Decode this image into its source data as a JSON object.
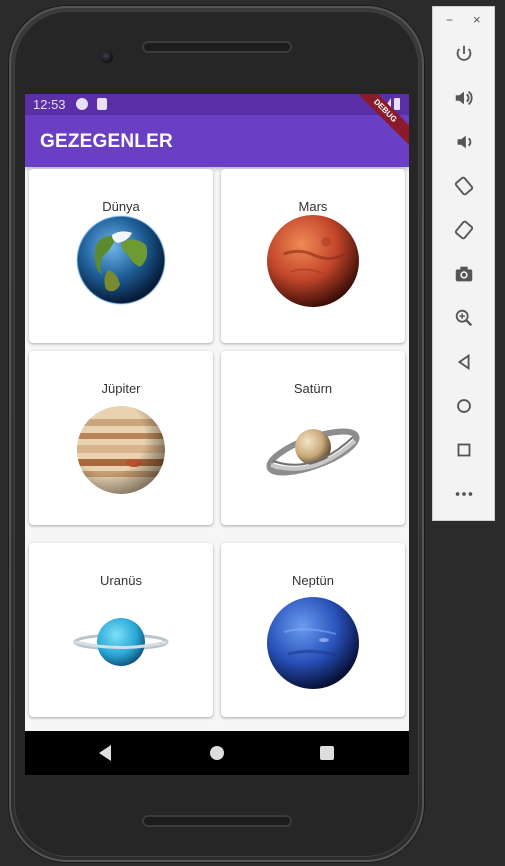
{
  "statusbar": {
    "time": "12:53"
  },
  "appbar": {
    "title": "GEZEGENLER",
    "debug_banner": "DEBUG"
  },
  "planets": [
    {
      "name": "Dünya",
      "icon": "earth-image"
    },
    {
      "name": "Mars",
      "icon": "mars-image"
    },
    {
      "name": "Jüpiter",
      "icon": "jupiter-image"
    },
    {
      "name": "Satürn",
      "icon": "saturn-image"
    },
    {
      "name": "Uranüs",
      "icon": "uranus-image"
    },
    {
      "name": "Neptün",
      "icon": "neptune-image"
    }
  ],
  "toolbar": {
    "minimize": "−",
    "close": "×",
    "buttons": [
      "power-icon",
      "volume-up-icon",
      "volume-down-icon",
      "rotate-left-icon",
      "rotate-right-icon",
      "camera-icon",
      "zoom-icon",
      "back-icon",
      "home-icon",
      "overview-icon",
      "more-icon"
    ]
  },
  "colors": {
    "statusbar": "#5a2fa8",
    "appbar": "#6b3fc4",
    "debug": "#8b1a2b"
  }
}
